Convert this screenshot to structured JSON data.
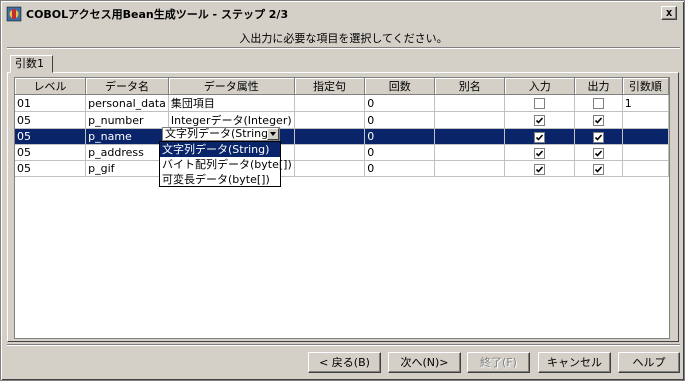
{
  "window": {
    "title": "COBOLアクセス用Bean生成ツール - ステップ 2/3",
    "close_label": "x"
  },
  "instruction": "入出力に必要な項目を選択してください。",
  "tab": {
    "label": "引数1"
  },
  "table": {
    "columns": [
      "レベル",
      "データ名",
      "データ属性",
      "指定句",
      "回数",
      "別名",
      "入力",
      "出力",
      "引数順"
    ],
    "rows": [
      {
        "level": "01",
        "name": "personal_data",
        "attr": "集団項目",
        "clause": "",
        "count": "0",
        "alias": "",
        "input": false,
        "output": false,
        "order": "1"
      },
      {
        "level": "05",
        "name": "p_number",
        "attr": "Integerデータ(Integer)",
        "clause": "",
        "count": "0",
        "alias": "",
        "input": true,
        "output": true,
        "order": ""
      },
      {
        "level": "05",
        "name": "p_name",
        "attr": "文字列データ(String)",
        "clause": "",
        "count": "0",
        "alias": "",
        "input": true,
        "output": true,
        "order": ""
      },
      {
        "level": "05",
        "name": "p_address",
        "attr": "",
        "clause": "",
        "count": "0",
        "alias": "",
        "input": true,
        "output": true,
        "order": ""
      },
      {
        "level": "05",
        "name": "p_gif",
        "attr": "",
        "clause": "",
        "count": "0",
        "alias": "",
        "input": true,
        "output": true,
        "order": ""
      }
    ],
    "selected_row": 2
  },
  "combo": {
    "value": "文字列データ(String)"
  },
  "dropdown": {
    "options": [
      "文字列データ(String)",
      "バイト配列データ(byte[])",
      "可変長データ(byte[])"
    ],
    "selected": 0
  },
  "buttons": {
    "back": "< 戻る(B)",
    "next": "次へ(N)>",
    "finish": "終了(F)",
    "cancel": "キャンセル",
    "help": "ヘルプ"
  },
  "colors": {
    "selection": "#0a246a",
    "face": "#d4d0c8"
  }
}
